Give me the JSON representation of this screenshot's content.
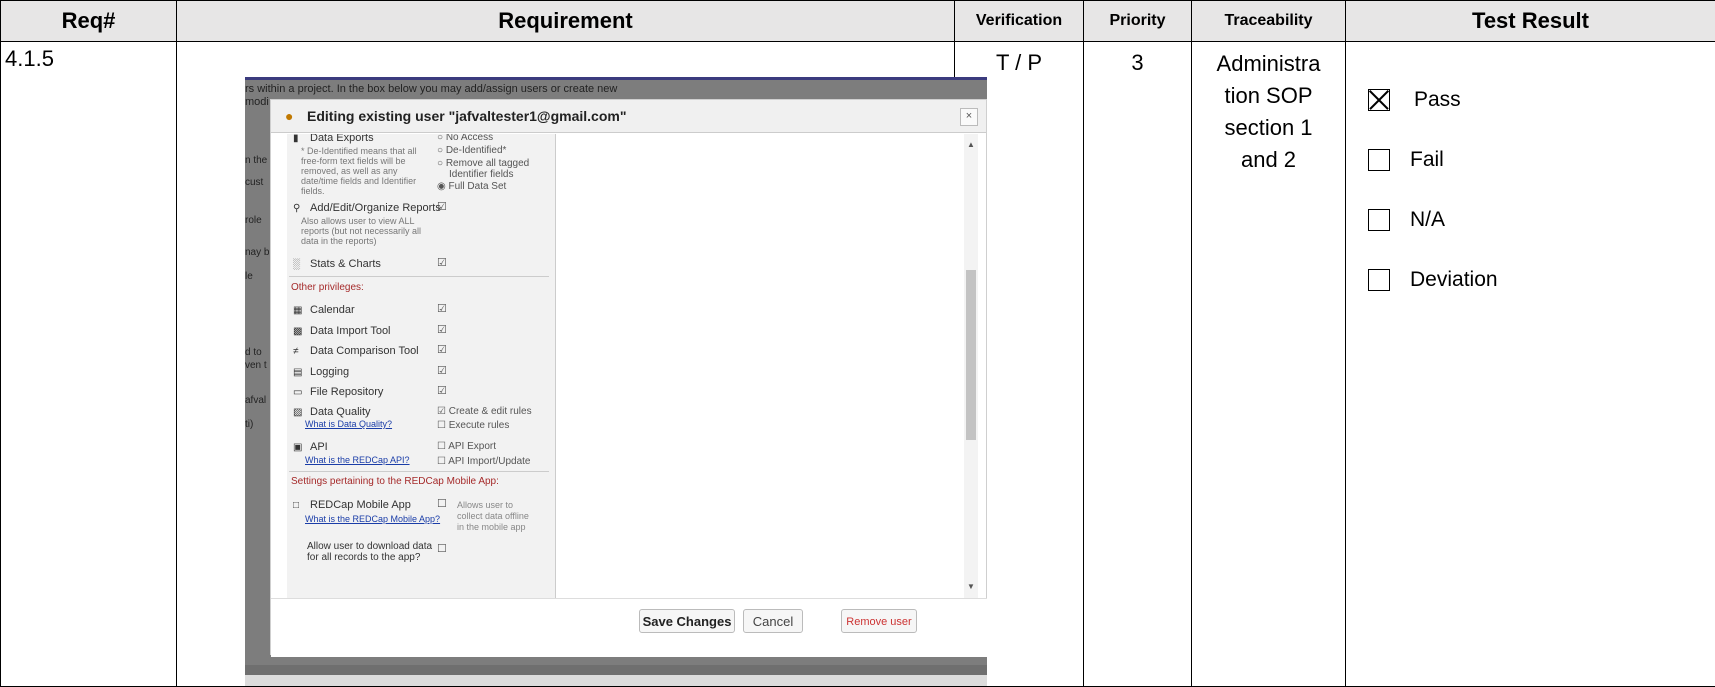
{
  "table": {
    "headers": {
      "req": "Req#",
      "requirement": "Requirement",
      "verification": "Verification",
      "priority": "Priority",
      "traceability": "Traceability",
      "test_result": "Test Result"
    },
    "row": {
      "req_num": "4.1.5",
      "verification": "T / P",
      "priority": "3",
      "traceability_lines": [
        "Administra",
        "tion SOP",
        "section 1",
        "and 2"
      ],
      "results": [
        {
          "label": "Pass",
          "checked": true
        },
        {
          "label": "Fail",
          "checked": false
        },
        {
          "label": "N/A",
          "checked": false
        },
        {
          "label": "Deviation",
          "checked": false
        }
      ]
    }
  },
  "screenshot": {
    "bg_text_1": "rs within a project. In the box below you may add/assign users or create new",
    "bg_text_2": "modi",
    "side_fragments": [
      "n the",
      "cust",
      "role",
      "nay b",
      "le",
      "d to",
      "ven t",
      "afval",
      "ti)"
    ],
    "dialog_title": "Editing existing user \"jafvaltester1@gmail.com\"",
    "close_glyph": "×",
    "data_exports": {
      "label": "Data Exports",
      "note": [
        "* De-Identified means that all",
        "free-form text fields will be",
        "removed, as well as any",
        "date/time fields and Identifier",
        "fields."
      ],
      "options": [
        "No Access",
        "De-Identified*",
        "Remove all tagged",
        "Identifier fields",
        "Full Data Set"
      ]
    },
    "reports": {
      "label": "Add/Edit/Organize Reports",
      "note": [
        "Also allows user to view ALL",
        "reports (but not necessarily all",
        "data in the reports)"
      ]
    },
    "stats_label": "Stats & Charts",
    "other_privileges": "Other privileges:",
    "privileges": [
      "Calendar",
      "Data Import Tool",
      "Data Comparison Tool",
      "Logging",
      "File Repository"
    ],
    "data_quality": {
      "label": "Data Quality",
      "link": "What is Data Quality?",
      "opt1": "Create & edit rules",
      "opt2": "Execute rules"
    },
    "api": {
      "label": "API",
      "link": "What is the REDCap API?",
      "opt1": "API Export",
      "opt2": "API Import/Update"
    },
    "mobile_section": "Settings pertaining to the REDCap Mobile App:",
    "mobile": {
      "label": "REDCap Mobile App",
      "link": "What is the REDCap Mobile App?",
      "note": [
        "Allows user to",
        "collect data offline",
        "in the mobile app"
      ]
    },
    "download": [
      "Allow user to download data",
      "for all records to the app?"
    ],
    "buttons": {
      "save": "Save Changes",
      "cancel": "Cancel",
      "remove": "Remove user"
    },
    "colors": {
      "section_red": "#a52a2a",
      "link_blue": "#1a3da8",
      "header_gray": "#e7e6e6"
    }
  }
}
